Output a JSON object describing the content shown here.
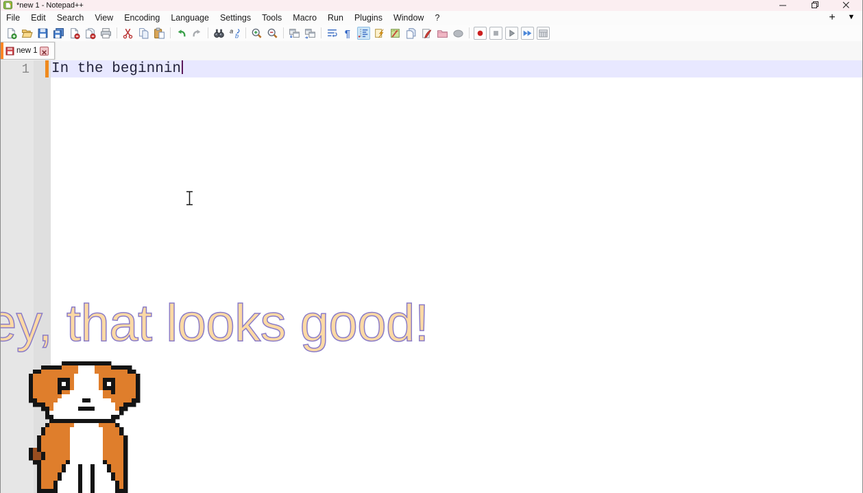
{
  "window": {
    "title": "*new 1 - Notepad++",
    "app_icon": "notepad-plus-plus-icon",
    "controls": [
      "minimize",
      "maximize",
      "close"
    ]
  },
  "menu": {
    "items": [
      "File",
      "Edit",
      "Search",
      "View",
      "Encoding",
      "Language",
      "Settings",
      "Tools",
      "Macro",
      "Run",
      "Plugins",
      "Window",
      "?"
    ],
    "new_tab_button": "+",
    "tab_list_button": "▼"
  },
  "toolbar": {
    "active_icon": "show-indent-guide",
    "boxed_group_index": 7,
    "groups": [
      [
        "new-file",
        "open-file",
        "save-file",
        "save-all",
        "close-file",
        "close-all",
        "print"
      ],
      [
        "cut",
        "copy",
        "paste"
      ],
      [
        "undo",
        "redo"
      ],
      [
        "find",
        "replace"
      ],
      [
        "zoom-in",
        "zoom-out"
      ],
      [
        "sync-scroll-vertical",
        "sync-scroll-horizontal"
      ],
      [
        "word-wrap",
        "show-all-characters",
        "show-indent-guide",
        "function-list",
        "document-map",
        "document-list",
        "document-edit",
        "folder-as-workspace",
        "monitoring"
      ],
      [
        "start-record-macro",
        "stop-record-macro",
        "playback-macro",
        "run-macro-multiple-times",
        "save-recorded-macro"
      ]
    ]
  },
  "tabbar": {
    "tabs": [
      {
        "label": "new 1",
        "modified": true,
        "active": true,
        "icons": [
          "unsaved-floppy-icon",
          "close-x-icon"
        ]
      }
    ]
  },
  "editor": {
    "lines": [
      {
        "number": "1",
        "text": "In the beginnin"
      }
    ],
    "caret_visible": true
  },
  "overlay": {
    "message": "ey, that looks good!",
    "dog": {
      "cell": 6,
      "palette": {
        "K": "#141414",
        "O": "#df7e2c",
        "W": "#ffffff",
        "B": "#9a4e20"
      },
      "rows": [
        "........KKKKKKKKKKKK........",
        "...KKKKKOOOOWWWWOOOOKKKKK...",
        ".KKOOOOOOOOOWWWWOOOOOOOOKK..",
        "KOOOOOOOOOOWWWWWWOOOOOOOOOK.",
        "KOOOOOOKKKOWWWWWWOKKKOOOOOK.",
        "KOOOOOOKWKOWWWWWWOKWKOOOOOK.",
        "KOOOOOOKKKOWWWWWWOKKKOOOOOK.",
        "KOOOOOOKOOWWWWWWWWOOKOOOOOK.",
        "KOOOOOOOWWWWWWWWWWOOOOOOOOK.",
        "KKOOOOOWWWWWWKKWWWWWOOOOOKK.",
        ".KKKOOWWWWWWWWWWWWWWWOOKKK..",
        "...KKOWWWWWWKKKKWWWWWOKK....",
        "....KWWWWWWWWWWWWWWWWWK.....",
        "....KKWWWWWWWWWWWWWWKK......",
        ".....KKKKKKKKKKKKKKKK.......",
        "....KOOOOOOWWWWWWOOOOK......",
        "...KOOOOOOWWWWWWWWOOOOK.....",
        "...KOOOOOOWWWWWWWWOOOOK.....",
        "..KOOOOOOOWWWWWWWWOOOOOK....",
        "..KOOOOOOOWWWWWWWWOOOOOK....",
        "..KOOOOOOOWWWWWWWWOOOOOK....",
        "KBKOOOOOOOWWWWWWWWOOOOOK....",
        "KBBKOOOOOOWWWWWWWWOOOOOK....",
        "KBBKOOOOOOWWWWWWWWOOOOOK....",
        ".KKOOOOOOKWWWWWWWWKOOOOK....",
        "..KOOOOOKWWWKWWKWWWKOOOK....",
        "..KOOOOOKWWWKWWKWWWKOOOK....",
        "..KOOOOKWWWWKWWKWWWWKOOK....",
        "..KOOOOKWWWWKWWKWWWWKOOK....",
        "..KOOOKWWWWWKWWKWWWWWKOK....",
        "..KOOOKWWWWWKWWKWWWWWKOK....",
        "..KKKKKWWWWWKWWKWWWWWKKK...."
      ]
    }
  },
  "pointer": {
    "type": "i-beam-cursor"
  },
  "colors": {
    "titlebar_bg": "#fbeef1",
    "accent_orange": "#ff8624",
    "change_marker": "#ef8a1e",
    "current_line_bg": "#e8e8ff",
    "margin_bg": "#e6e6e6",
    "fold_margin_bg": "#dfdfdf",
    "line_number": "#8a8a8a",
    "text": "#23233a",
    "caret": "#5c1a5c",
    "overlay_fill": "#fcd9a4",
    "overlay_stroke": "#8a7cc8"
  }
}
